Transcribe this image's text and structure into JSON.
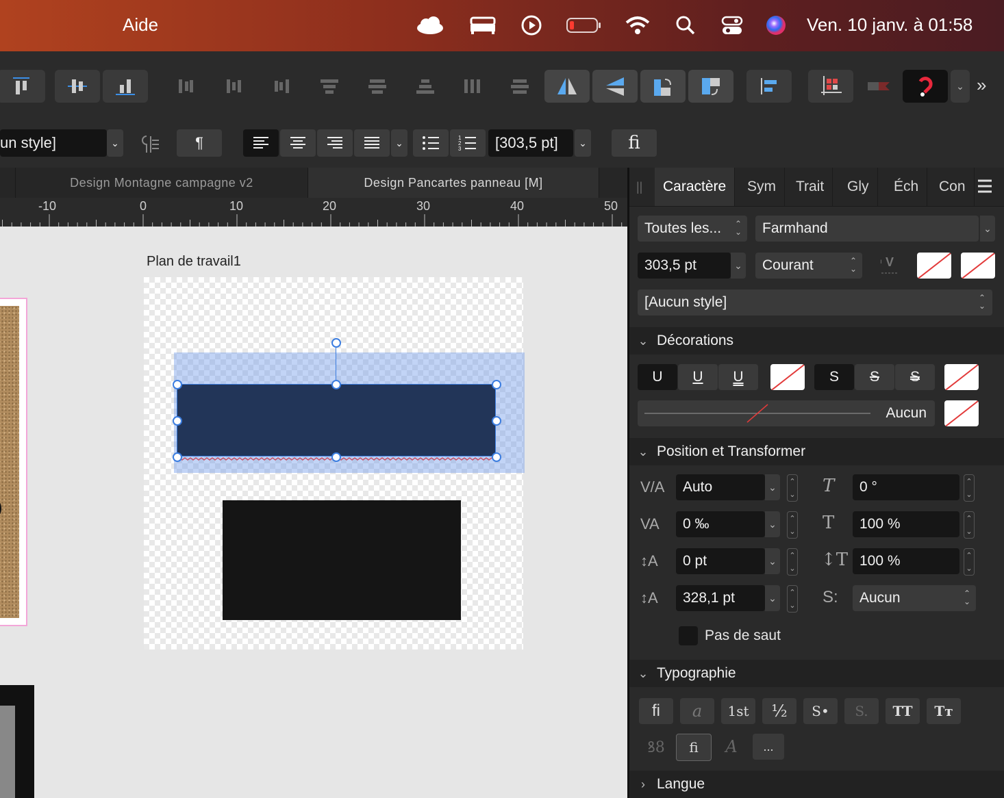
{
  "menubar": {
    "menu_item": "Aide",
    "datetime": "Ven. 10 janv. à 01:58"
  },
  "context_bar": {
    "style_value": "un style]",
    "font_size_value": "[303,5 pt]",
    "ligature_label": "fi",
    "paragraph_label": "¶"
  },
  "tabs": [
    {
      "label": "Design Montagne campagne v2"
    },
    {
      "label": "Design Pancartes  panneau [M]"
    }
  ],
  "ruler": {
    "labels": [
      "-10",
      "0",
      "10",
      "20",
      "30",
      "40",
      "50"
    ]
  },
  "canvas": {
    "artboard_title": "Plan de travail1"
  },
  "panel": {
    "tabs": [
      "Caractère",
      "Sym",
      "Trait",
      "Gly",
      "Éch",
      "Con"
    ],
    "font_collection": "Toutes les...",
    "font_family": "Farmhand",
    "font_size": "303,5 pt",
    "font_style": "Courant",
    "char_style": "[Aucun style]",
    "decorations": {
      "title": "Décorations",
      "underline_glyph": "U",
      "strike_glyph": "S",
      "line_label": "Aucun"
    },
    "position": {
      "title": "Position et Transformer",
      "kerning": "Auto",
      "tracking": "0 ‰",
      "baseline": "0 pt",
      "leading": "328,1 pt",
      "shear": "0 °",
      "vscale": "100 %",
      "hscale": "100 %",
      "script": "Aucun",
      "no_break": "Pas de saut"
    },
    "typography": {
      "title": "Typographie",
      "buttons": [
        "fi",
        "a",
        "1st",
        "½",
        "S•",
        "S.",
        "TT",
        "Tт"
      ],
      "row2": [
        "ꝸ8",
        "fi",
        "A",
        "..."
      ]
    },
    "language": {
      "title": "Langue"
    }
  },
  "colors": {
    "selected_rect": "#223558",
    "black_rect": "#151515",
    "accent": "#3b7de0"
  }
}
